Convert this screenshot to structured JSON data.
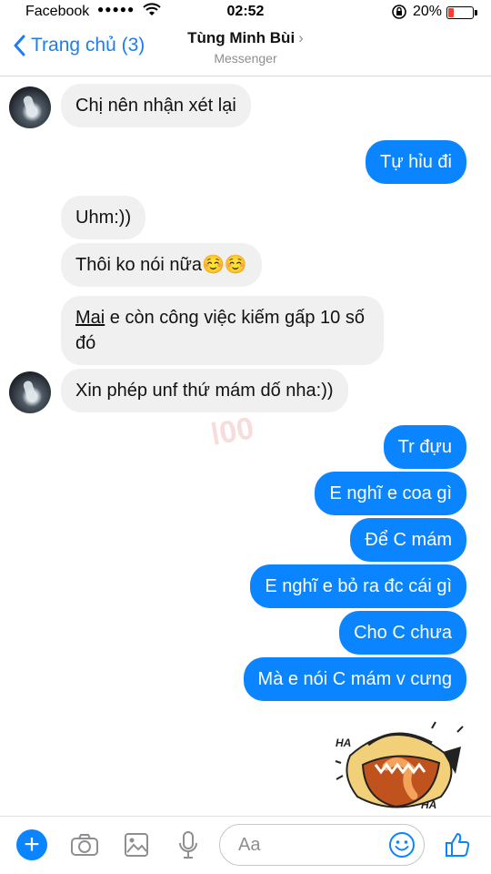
{
  "status_bar": {
    "carrier": "Facebook",
    "signal_dots": "●●●●●",
    "time": "02:52",
    "battery_percent": "20%",
    "battery_level": 0.2,
    "battery_color": "#ff3b30"
  },
  "header": {
    "back_label": "Trang chủ (3)",
    "contact_name": "Tùng Minh Bùi",
    "subtitle": "Messenger",
    "accent_color": "#1e7ef0"
  },
  "messages": [
    {
      "side": "in",
      "text": "Chị nên nhận xét lại"
    },
    {
      "side": "out",
      "text": "Tự hỉu đi"
    },
    {
      "side": "in",
      "text": "Uhm:))"
    },
    {
      "side": "in",
      "text": "Thôi ko nói nữa☺️☺️"
    },
    {
      "side": "in",
      "text_underlined": "Mai",
      "text": " e còn công việc kiếm gấp 10 số đó"
    },
    {
      "side": "in",
      "text": "Xin phép unf thứ mám dố nha:))"
    },
    {
      "side": "out",
      "text": "Tr đựu"
    },
    {
      "side": "out",
      "text": "E nghĩ e coa gì"
    },
    {
      "side": "out",
      "text": "Để C mám"
    },
    {
      "side": "out",
      "text": "E nghĩ e bỏ ra đc cái gì"
    },
    {
      "side": "out",
      "text": "Cho C chưa"
    },
    {
      "side": "out",
      "text": "Mà e nói C mám v cưng"
    }
  ],
  "sticker": {
    "icon": "laughing-face-sticker",
    "ha_top": "HA",
    "ha_bottom": "HA"
  },
  "composer": {
    "placeholder": "Aa",
    "icons": [
      "plus-icon",
      "camera-icon",
      "image-icon",
      "microphone-icon",
      "emoji-icon",
      "thumbs-up-icon"
    ]
  },
  "colors": {
    "outgoing": "#0b84ff",
    "incoming": "#f1f0f0"
  }
}
